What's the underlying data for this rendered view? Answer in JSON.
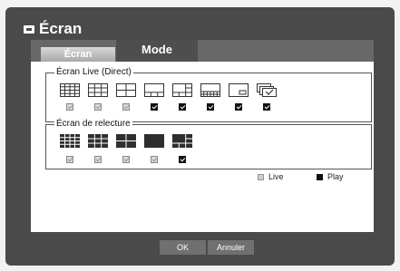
{
  "window": {
    "title": "Écran",
    "icon": "monitor-icon"
  },
  "tabs": [
    {
      "label": "Écran",
      "active": false
    },
    {
      "label": "Mode",
      "active": true
    }
  ],
  "live_group": {
    "label": "Écran Live (Direct)",
    "layouts": [
      {
        "name": "grid-4x4-layout-icon",
        "checked": false
      },
      {
        "name": "grid-3x3-layout-icon",
        "checked": false
      },
      {
        "name": "grid-2x2-layout-icon",
        "checked": false
      },
      {
        "name": "one-plus-3-layout-icon",
        "checked": true
      },
      {
        "name": "one-plus-5-layout-icon",
        "checked": true
      },
      {
        "name": "one-plus-7-layout-icon",
        "checked": true
      },
      {
        "name": "pip-layout-icon",
        "checked": true
      },
      {
        "name": "sequence-layout-icon",
        "checked": true
      }
    ]
  },
  "play_group": {
    "label": "Écran de relecture",
    "layouts": [
      {
        "name": "grid-4x4-layout-icon",
        "checked": false
      },
      {
        "name": "grid-3x3-layout-icon",
        "checked": false
      },
      {
        "name": "grid-2x2-layout-icon",
        "checked": false
      },
      {
        "name": "single-layout-icon",
        "checked": false
      },
      {
        "name": "one-plus-5-layout-icon",
        "checked": true
      }
    ]
  },
  "legend": {
    "live_label": "Live",
    "play_label": "Play"
  },
  "buttons": {
    "ok": "OK",
    "cancel": "Annuler"
  },
  "colors": {
    "frame": "#4a4a4a",
    "tab_active": "#4e4e4e",
    "checked": "#111111",
    "unchecked": "#d9d9d9"
  }
}
